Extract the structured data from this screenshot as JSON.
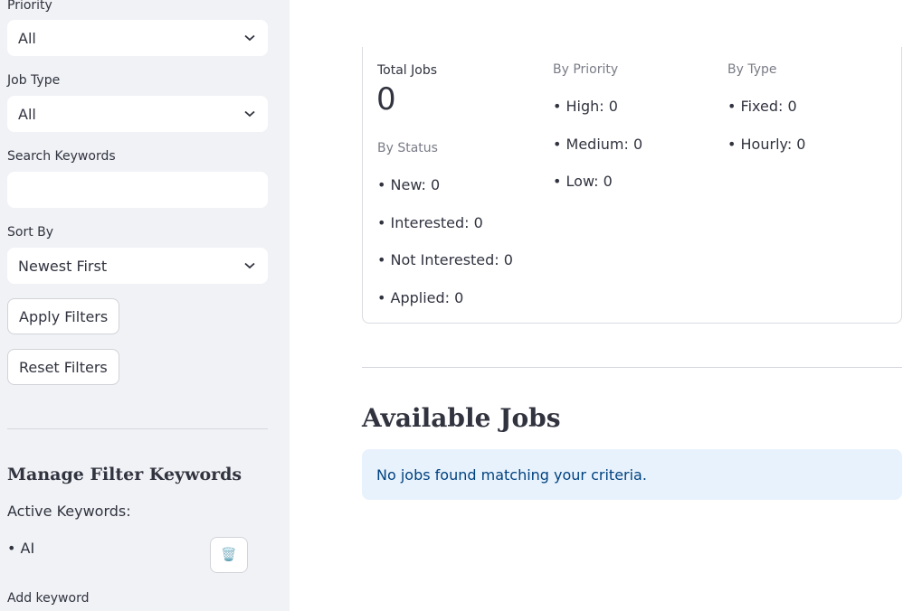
{
  "sidebar": {
    "priority": {
      "label": "Priority",
      "value": "All"
    },
    "job_type": {
      "label": "Job Type",
      "value": "All"
    },
    "search": {
      "label": "Search Keywords",
      "value": ""
    },
    "sort_by": {
      "label": "Sort By",
      "value": "Newest First"
    },
    "apply_label": "Apply Filters",
    "reset_label": "Reset Filters",
    "manage_title": "Manage Filter Keywords",
    "active_keywords_label": "Active Keywords:",
    "keywords": [
      "• AI"
    ],
    "delete_icon": "🗑️",
    "add_keyword_label": "Add keyword"
  },
  "summary": {
    "total_label": "Total Jobs",
    "total_value": "0",
    "by_status_label": "By Status",
    "status": [
      "• New: 0",
      "• Interested: 0",
      "• Not Interested: 0",
      "• Applied: 0"
    ],
    "by_priority_label": "By Priority",
    "priority": [
      "• High: 0",
      "• Medium: 0",
      "• Low: 0"
    ],
    "by_type_label": "By Type",
    "type": [
      "• Fixed: 0",
      "• Hourly: 0"
    ]
  },
  "jobs": {
    "title": "Available Jobs",
    "empty_message": "No jobs found matching your criteria."
  }
}
